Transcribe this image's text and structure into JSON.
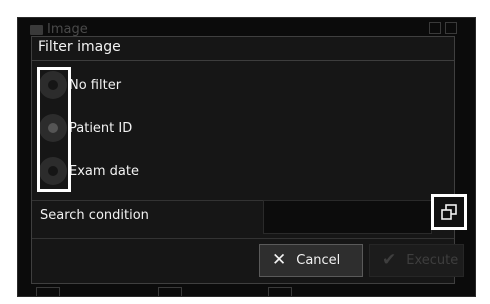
{
  "background": {
    "window_title": "Image"
  },
  "dialog": {
    "title": "Filter image",
    "options": [
      {
        "label": "No filter",
        "selected": false
      },
      {
        "label": "Patient ID",
        "selected": true
      },
      {
        "label": "Exam date",
        "selected": false
      }
    ],
    "search": {
      "label": "Search condition",
      "value": ""
    },
    "buttons": {
      "cancel": {
        "label": "Cancel",
        "icon": "close-icon"
      },
      "execute": {
        "label": "Execute",
        "icon": "checkmark-icon",
        "enabled": false
      }
    }
  },
  "colors": {
    "dialog_bg": "#161616",
    "text": "#f2f2f2",
    "disabled_text": "#3e3e3e",
    "highlight": "#ffffff"
  }
}
